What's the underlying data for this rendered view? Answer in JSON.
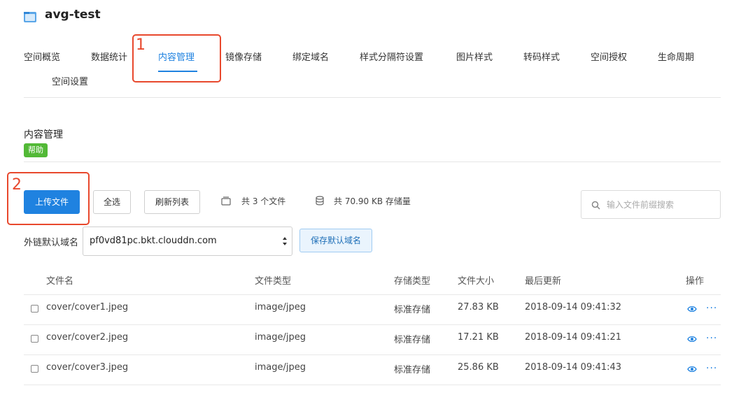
{
  "header": {
    "title": "avg-test"
  },
  "tabs": [
    {
      "label": "空间概览"
    },
    {
      "label": "数据统计"
    },
    {
      "label": "内容管理",
      "active": true
    },
    {
      "label": "镜像存储"
    },
    {
      "label": "绑定域名"
    },
    {
      "label": "样式分隔符设置"
    },
    {
      "label": "图片样式"
    },
    {
      "label": "转码样式"
    },
    {
      "label": "空间授权"
    },
    {
      "label": "生命周期"
    },
    {
      "label": "空间设置"
    }
  ],
  "annotations": {
    "first": "1",
    "second": "2",
    "color": "#e8482d"
  },
  "section": {
    "title": "内容管理",
    "help": "帮助"
  },
  "toolbar": {
    "upload": "上传文件",
    "select_all": "全选",
    "refresh": "刷新列表",
    "file_count": "共 3 个文件",
    "storage": "共 70.90 KB 存储量"
  },
  "search": {
    "placeholder": "输入文件前缀搜索"
  },
  "domain": {
    "label": "外链默认域名",
    "value": "pf0vd81pc.bkt.clouddn.com",
    "save": "保存默认域名"
  },
  "table": {
    "headers": [
      "文件名",
      "文件类型",
      "存储类型",
      "文件大小",
      "最后更新",
      "操作"
    ],
    "rows": [
      {
        "name": "cover/cover1.jpeg",
        "type": "image/jpeg",
        "storage": "标准存储",
        "size": "27.83 KB",
        "updated": "2018-09-14 09:41:32"
      },
      {
        "name": "cover/cover2.jpeg",
        "type": "image/jpeg",
        "storage": "标准存储",
        "size": "17.21 KB",
        "updated": "2018-09-14 09:41:21"
      },
      {
        "name": "cover/cover3.jpeg",
        "type": "image/jpeg",
        "storage": "标准存储",
        "size": "25.86 KB",
        "updated": "2018-09-14 09:41:43"
      }
    ],
    "more_glyph": "···"
  },
  "colors": {
    "accent": "#1f82e0",
    "help": "#52b936"
  }
}
